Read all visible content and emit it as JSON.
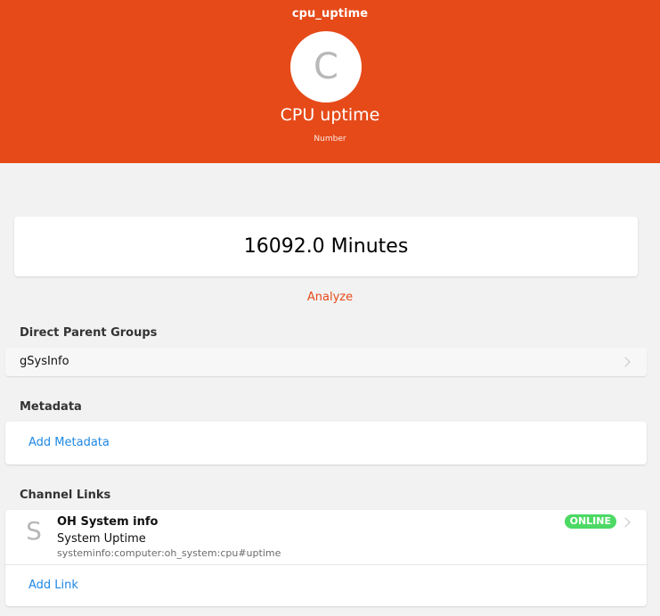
{
  "header": {
    "item_name": "cpu_uptime",
    "avatar_letter": "C",
    "label": "CPU uptime",
    "type": "Number"
  },
  "state": {
    "value": "16092.0 Minutes"
  },
  "actions": {
    "analyze_label": "Analyze"
  },
  "groups": {
    "title": "Direct Parent Groups",
    "items": [
      {
        "label": "gSysInfo"
      }
    ]
  },
  "metadata": {
    "title": "Metadata",
    "add_label": "Add Metadata"
  },
  "channel_links": {
    "title": "Channel Links",
    "items": [
      {
        "avatar_letter": "S",
        "thing_label": "OH System info",
        "channel_label": "System Uptime",
        "uid": "systeminfo:computer:oh_system:cpu#uptime",
        "status": "ONLINE"
      }
    ],
    "add_label": "Add Link"
  },
  "colors": {
    "accent": "#e64a19",
    "link_blue": "#1e88e5",
    "online_green": "#4cd964",
    "background": "#f2f2f2"
  }
}
